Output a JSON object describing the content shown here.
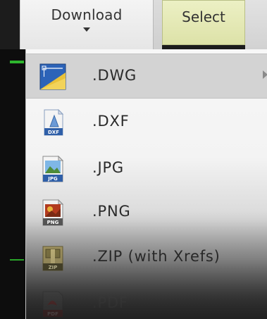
{
  "toolbar": {
    "download_label": "Download",
    "select_label": "Select"
  },
  "menu": {
    "items": [
      {
        "label": ".DWG",
        "icon": "dwg-file-icon",
        "highlighted": true,
        "has_submenu": true
      },
      {
        "label": ".DXF",
        "icon": "dxf-file-icon",
        "badge": "DXF"
      },
      {
        "label": ".JPG",
        "icon": "jpg-file-icon",
        "badge": "JPG"
      },
      {
        "label": ".PNG",
        "icon": "png-file-icon",
        "badge": "PNG"
      },
      {
        "label": ".ZIP (with Xrefs)",
        "icon": "zip-file-icon",
        "badge": "ZIP"
      },
      {
        "label": ".PDF",
        "icon": "pdf-file-icon",
        "badge": "PDF"
      }
    ]
  },
  "colors": {
    "select_bg": "#e4e8b4",
    "accent_green": "#2db52d",
    "hover_bg": "#cdcdcd"
  }
}
